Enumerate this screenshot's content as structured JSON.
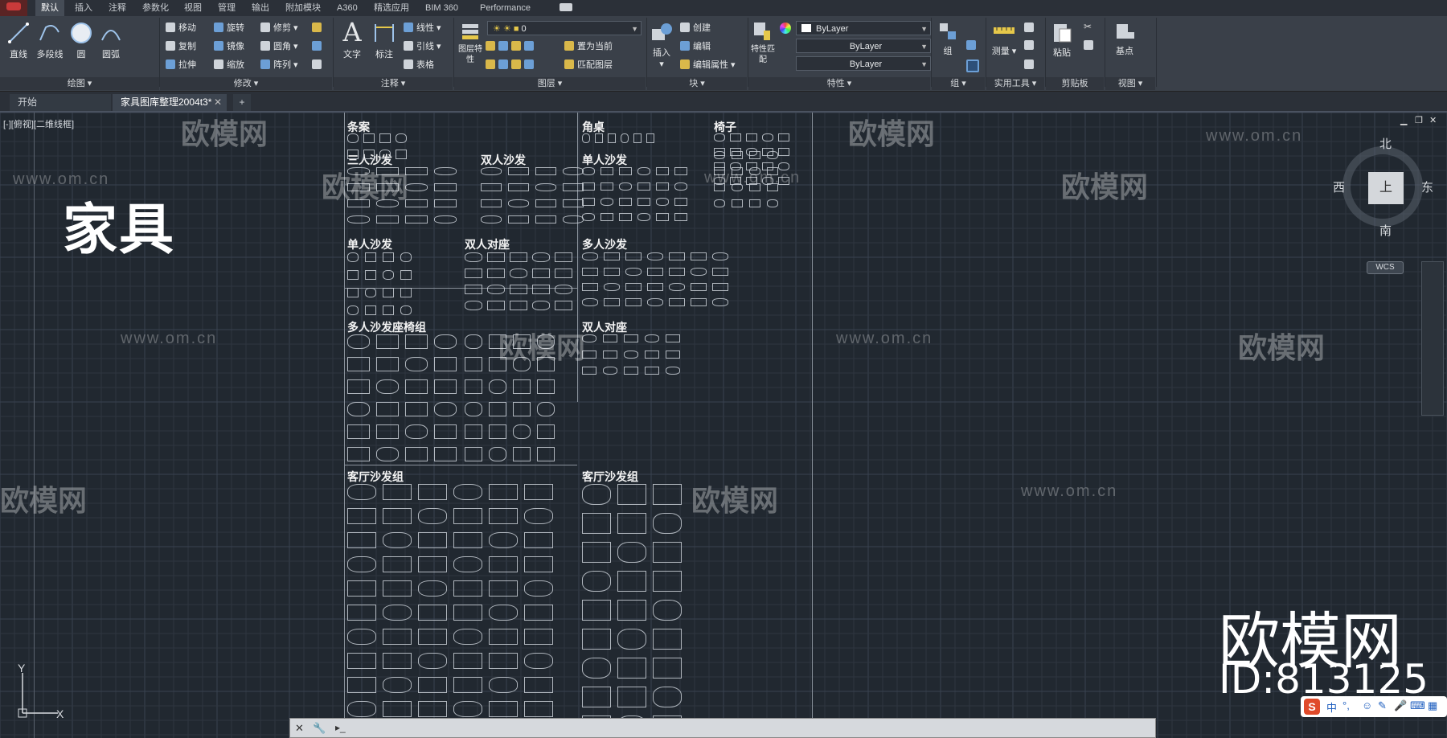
{
  "ribbon_tabs": [
    {
      "label": "默认",
      "active": true
    },
    {
      "label": "插入"
    },
    {
      "label": "注释"
    },
    {
      "label": "参数化"
    },
    {
      "label": "视图"
    },
    {
      "label": "管理"
    },
    {
      "label": "输出"
    },
    {
      "label": "附加模块"
    },
    {
      "label": "A360"
    },
    {
      "label": "精选应用"
    },
    {
      "label": "BIM 360"
    },
    {
      "label": "Performance"
    }
  ],
  "panels": {
    "draw": {
      "title": "绘图",
      "line": "直线",
      "polyline": "多段线",
      "circle": "圆",
      "arc": "圆弧"
    },
    "modify": {
      "title": "修改",
      "move": "移动",
      "rotate": "旋转",
      "trim": "修剪",
      "copy": "复制",
      "mirror": "镜像",
      "fillet": "圆角",
      "stretch": "拉伸",
      "scale": "缩放",
      "array": "阵列"
    },
    "annotation": {
      "title": "注释",
      "text": "文字",
      "dimension": "标注",
      "linear": "线性",
      "leader": "引线",
      "table": "表格"
    },
    "layers": {
      "title": "图层",
      "layer_props": "图层特性",
      "current_layer": "0",
      "set_current": "置为当前",
      "match_layer": "匹配图层"
    },
    "block": {
      "title": "块",
      "insert": "插入",
      "create": "创建",
      "edit": "编辑",
      "edit_attr": "编辑属性"
    },
    "properties": {
      "title": "特性",
      "match": "特性匹配",
      "color": "ByLayer",
      "linetype": "ByLayer",
      "lineweight": "ByLayer"
    },
    "groups": {
      "title": "组",
      "group": "组"
    },
    "utilities": {
      "title": "实用工具",
      "measure": "测量"
    },
    "clipboard": {
      "title": "剪贴板",
      "paste": "粘贴"
    },
    "view": {
      "title": "视图",
      "base": "基点"
    }
  },
  "doc_tabs": [
    {
      "label": "开始"
    },
    {
      "label": "家具图库整理2004t3*",
      "active": true
    }
  ],
  "viewport_label": "[-][俯视][二维线框]",
  "canvas": {
    "big_title": "家具",
    "sections": [
      {
        "label": "条案"
      },
      {
        "label": "角桌"
      },
      {
        "label": "椅子"
      },
      {
        "label": "三人沙发"
      },
      {
        "label": "双人沙发"
      },
      {
        "label": "单人沙发"
      },
      {
        "label": "单人沙发"
      },
      {
        "label": "双人对座"
      },
      {
        "label": "多人沙发"
      },
      {
        "label": "多人沙发座椅组"
      },
      {
        "label": "双人对座"
      },
      {
        "label": "客厅沙发组"
      },
      {
        "label": "客厅沙发组"
      }
    ]
  },
  "viewcube": {
    "north": "北",
    "south": "南",
    "west": "西",
    "east": "东",
    "face": "上",
    "wcs": "WCS"
  },
  "ucs": {
    "x": "X",
    "y": "Y"
  },
  "watermark": {
    "url": "www.om.cn",
    "logo": "欧模网"
  },
  "brand": {
    "name": "欧模网",
    "id": "ID:813125"
  },
  "ime": {
    "lang": "中",
    "punct": "°,"
  },
  "colors": {
    "ribbon_bg": "#3a4049",
    "canvas_bg": "#212830",
    "grid_line": "#2e3640",
    "grid_major": "#394250"
  }
}
